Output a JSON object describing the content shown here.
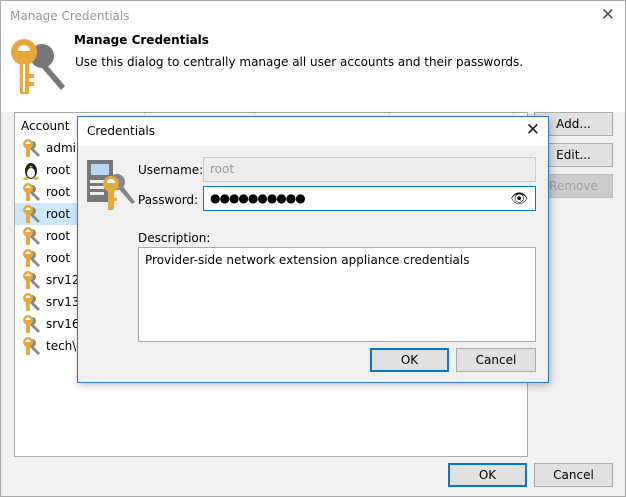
{
  "window": {
    "title": "Manage Credentials",
    "close": "✕"
  },
  "header": {
    "title": "Manage Credentials",
    "subtitle": "Use this dialog to centrally manage all user accounts and their passwords."
  },
  "list": {
    "column": "Account",
    "rows": [
      {
        "label": "admin",
        "icon": "key-icon"
      },
      {
        "label": "root",
        "icon": "linux-icon"
      },
      {
        "label": "root",
        "icon": "key-icon"
      },
      {
        "label": "root",
        "icon": "key-icon",
        "selected": true
      },
      {
        "label": "root",
        "icon": "key-icon"
      },
      {
        "label": "root",
        "icon": "key-icon"
      },
      {
        "label": "srv12\\",
        "icon": "key-icon"
      },
      {
        "label": "srv13\\",
        "icon": "key-icon"
      },
      {
        "label": "srv16\\",
        "icon": "key-icon"
      },
      {
        "label": "tech\\w",
        "icon": "key-icon"
      }
    ]
  },
  "buttons": {
    "add": "Add...",
    "edit": "Edit...",
    "remove": "Remove",
    "ok": "OK",
    "cancel": "Cancel"
  },
  "dialog": {
    "title": "Credentials",
    "close": "✕",
    "username_label": "Username:",
    "username": "root",
    "password_label": "Password:",
    "password": "●●●●●●●●●●",
    "eye": "👁",
    "description_label": "Description:",
    "description": "Provider-side network extension appliance credentials",
    "ok": "OK",
    "cancel": "Cancel"
  },
  "colors": {
    "accent": "#0078d7",
    "selection": "#cce8ff",
    "key": "#e8a83a"
  }
}
